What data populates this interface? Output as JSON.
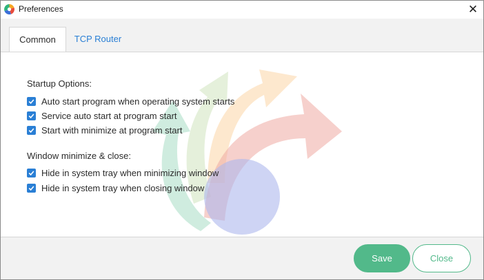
{
  "window": {
    "title": "Preferences"
  },
  "tabs": [
    {
      "label": "Common",
      "active": true
    },
    {
      "label": "TCP Router",
      "active": false
    }
  ],
  "startup": {
    "heading": "Startup Options:",
    "options": [
      {
        "label": "Auto start program when operating system starts",
        "checked": true
      },
      {
        "label": "Service auto start at program start",
        "checked": true
      },
      {
        "label": "Start with minimize at program start",
        "checked": true
      }
    ]
  },
  "minimize": {
    "heading": "Window minimize & close:",
    "options": [
      {
        "label": "Hide in system tray when minimizing window",
        "checked": true
      },
      {
        "label": "Hide in system tray when closing window",
        "checked": true
      }
    ]
  },
  "footer": {
    "save_label": "Save",
    "close_label": "Close"
  },
  "icons": {
    "app": "app-logo-icon",
    "close": "close-icon",
    "checkbox": "checkmark-icon"
  },
  "colors": {
    "accent_blue": "#2a7fd5",
    "accent_green": "#52b98a",
    "panel_bg": "#f2f2f2"
  }
}
